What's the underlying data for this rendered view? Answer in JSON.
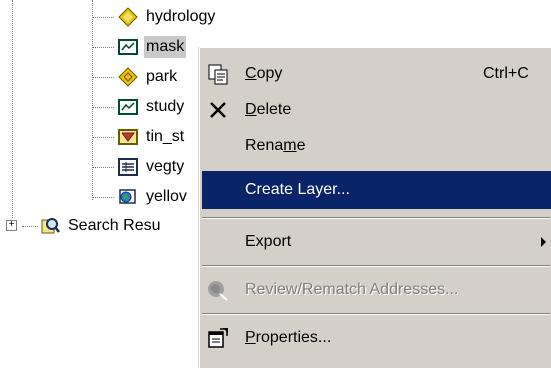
{
  "tree": {
    "items": [
      {
        "label": "hydrology",
        "icon": "point-layer-icon"
      },
      {
        "label": "mask",
        "icon": "raster-layer-icon",
        "selected": true
      },
      {
        "label": "park",
        "icon": "point-layer-icon"
      },
      {
        "label": "study",
        "icon": "raster-layer-icon"
      },
      {
        "label": "tin_st",
        "icon": "tin-layer-icon"
      },
      {
        "label": "vegty",
        "icon": "table-icon"
      },
      {
        "label": "yellov",
        "icon": "globe-map-icon"
      }
    ],
    "search_results": {
      "label": "Search Resu",
      "icon": "search-results-icon",
      "expander": "+"
    }
  },
  "context_menu": {
    "items": [
      {
        "id": "copy",
        "before": "",
        "mnemonic": "C",
        "after": "opy",
        "shortcut": "Ctrl+C",
        "icon": "copy-icon"
      },
      {
        "id": "delete",
        "before": "",
        "mnemonic": "D",
        "after": "elete",
        "icon": "delete-x-icon"
      },
      {
        "id": "rename",
        "before": "Rena",
        "mnemonic": "m",
        "after": "e"
      },
      {
        "id": "create_layer",
        "label": "Create Layer...",
        "highlighted": true
      },
      {
        "id": "export",
        "label": "Export",
        "submenu": true
      },
      {
        "id": "review_rematch",
        "label": "Review/Rematch Addresses...",
        "disabled": true,
        "icon": "review-addresses-icon"
      },
      {
        "id": "properties",
        "before": "",
        "mnemonic": "P",
        "after": "roperties...",
        "icon": "properties-icon"
      }
    ]
  },
  "colors": {
    "highlight": "#0a246a",
    "menu_bg": "#d4d0c8",
    "selection": "#c9c9c9"
  }
}
